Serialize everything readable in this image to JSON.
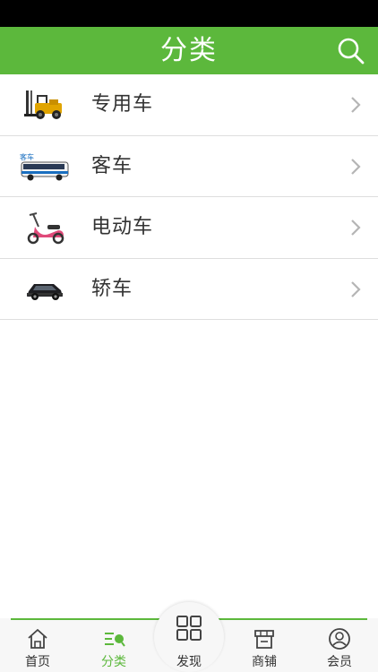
{
  "header": {
    "title": "分类",
    "search_icon": "search-icon",
    "background": "#5cb83c"
  },
  "categories": [
    {
      "label": "专用车",
      "thumbnail": "forklift-image"
    },
    {
      "label": "客车",
      "thumbnail": "bus-image",
      "thumbnail_text": "客车"
    },
    {
      "label": "电动车",
      "thumbnail": "electric-scooter-image"
    },
    {
      "label": "轿车",
      "thumbnail": "sedan-image"
    }
  ],
  "tabbar": {
    "accent": "#5cb83c",
    "items": [
      {
        "label": "首页",
        "icon": "home-icon",
        "active": false
      },
      {
        "label": "分类",
        "icon": "category-icon",
        "active": true
      },
      {
        "label": "发现",
        "icon": "grid-icon",
        "active": false
      },
      {
        "label": "商铺",
        "icon": "shop-icon",
        "active": false
      },
      {
        "label": "会员",
        "icon": "user-icon",
        "active": false
      }
    ]
  }
}
